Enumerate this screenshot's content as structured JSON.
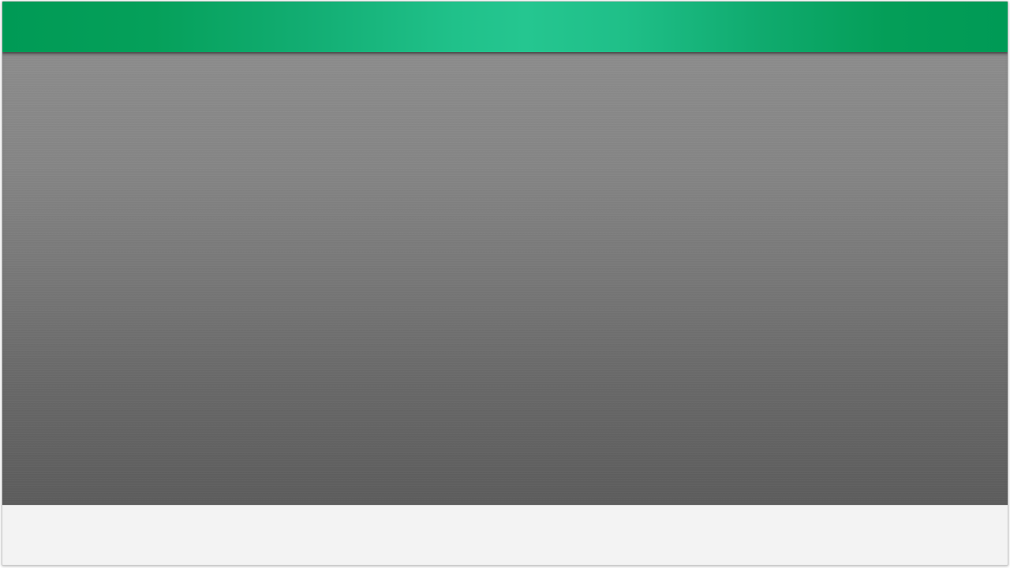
{
  "app": {
    "title": "",
    "header_gradient": [
      "#009a55",
      "#25c690",
      "#009a55"
    ]
  },
  "main": {
    "background_top": "#8c8c8c",
    "background_bottom": "#5c5c5c"
  },
  "footer": {
    "text": "",
    "background": "#f3f3f3"
  }
}
